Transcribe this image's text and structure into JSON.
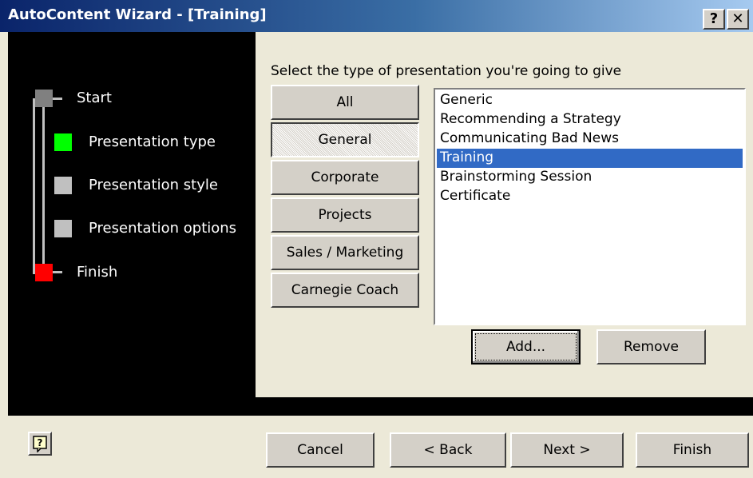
{
  "window": {
    "title": "AutoContent Wizard - [Training]",
    "help_glyph": "?",
    "close_glyph": "✕"
  },
  "steps": [
    {
      "label": "Start",
      "color": "#808080"
    },
    {
      "label": "Presentation type",
      "color": "#00ff00"
    },
    {
      "label": "Presentation style",
      "color": "#c0c0c0"
    },
    {
      "label": "Presentation options",
      "color": "#c0c0c0"
    },
    {
      "label": "Finish",
      "color": "#ff0000"
    }
  ],
  "main": {
    "prompt": "Select the type of presentation you're going to give",
    "categories": [
      {
        "label": "All"
      },
      {
        "label": "General",
        "pressed": true
      },
      {
        "label": "Corporate"
      },
      {
        "label": "Projects"
      },
      {
        "label": "Sales / Marketing"
      },
      {
        "label": "Carnegie Coach"
      }
    ],
    "list": [
      {
        "label": "Generic"
      },
      {
        "label": "Recommending a Strategy"
      },
      {
        "label": "Communicating Bad News"
      },
      {
        "label": "Training",
        "selected": true
      },
      {
        "label": "Brainstorming Session"
      },
      {
        "label": "Certificate"
      }
    ],
    "add_label": "Add...",
    "remove_label": "Remove"
  },
  "footer": {
    "cancel_label": "Cancel",
    "back_label": "< Back",
    "next_label": "Next >",
    "finish_label": "Finish"
  },
  "colors": {
    "selection": "#316ac5",
    "titlebar_start": "#0a246a",
    "face": "#d4d0c8"
  }
}
